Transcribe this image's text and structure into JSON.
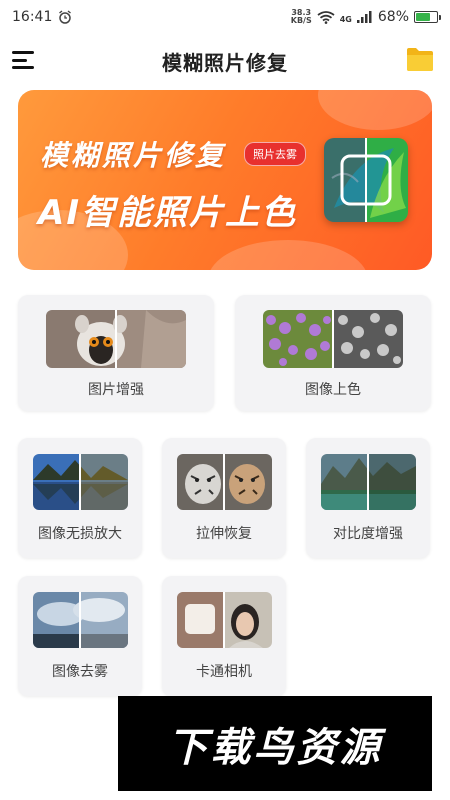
{
  "status_bar": {
    "time": "16:41",
    "net_speed_value": "38.3",
    "net_speed_unit": "KB/S",
    "network": "4G",
    "battery": "68%",
    "battery_level": 0.68
  },
  "header": {
    "title": "模糊照片修复"
  },
  "banner": {
    "title": "模糊照片修复",
    "badge": "照片去雾",
    "subtitle": "AI智能照片上色"
  },
  "features": {
    "enhance": "图片增强",
    "colorize": "图像上色",
    "upscale": "图像无损放大",
    "stretch_restore": "拉伸恢复",
    "contrast": "对比度增强",
    "dehaze": "图像去雾",
    "cartoon": "卡通相机"
  },
  "watermark": {
    "text": "下载鸟资源"
  },
  "colors": {
    "banner_orange": "#ff7c2a",
    "badge_red": "#e8302e",
    "card_bg": "#f3f3f5",
    "folder_yellow": "#f7c531"
  }
}
